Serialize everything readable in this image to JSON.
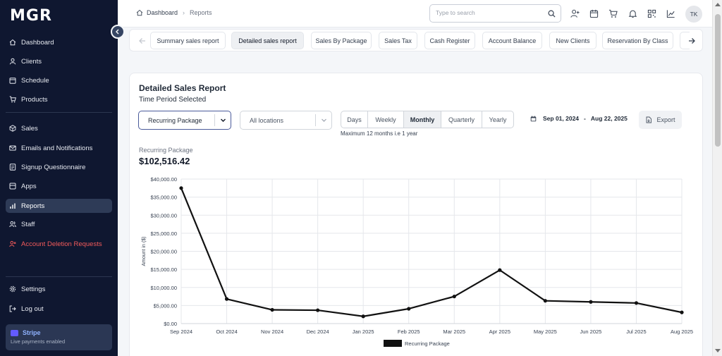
{
  "app": {
    "logo": "MGR"
  },
  "sidebar": {
    "items": [
      {
        "label": "Dashboard",
        "icon": "home-icon"
      },
      {
        "label": "Clients",
        "icon": "user-icon"
      },
      {
        "label": "Schedule",
        "icon": "calendar-icon"
      },
      {
        "label": "Products",
        "icon": "cart-icon"
      },
      {
        "label": "Sales",
        "icon": "box-icon"
      },
      {
        "label": "Emails and Notifications",
        "icon": "mail-icon"
      },
      {
        "label": "Signup Questionnaire",
        "icon": "form-icon"
      },
      {
        "label": "Apps",
        "icon": "apps-icon"
      },
      {
        "label": "Reports",
        "icon": "bar-chart-icon",
        "active": true
      },
      {
        "label": "Staff",
        "icon": "users-icon"
      },
      {
        "label": "Account Deletion Requests",
        "icon": "user-x-icon"
      },
      {
        "label": "Settings",
        "icon": "gear-icon"
      },
      {
        "label": "Log out",
        "icon": "logout-icon"
      }
    ],
    "stripe": {
      "title": "Stripe",
      "subtitle": "Live payments enabled"
    }
  },
  "topbar": {
    "breadcrumb": {
      "home": "Dashboard",
      "current": "Reports"
    },
    "search_placeholder": "Type to search",
    "avatar": "TK"
  },
  "tabs": [
    {
      "label": "Summary sales report"
    },
    {
      "label": "Detailed sales report",
      "active": true
    },
    {
      "label": "Sales By Package"
    },
    {
      "label": "Sales Tax"
    },
    {
      "label": "Cash Register"
    },
    {
      "label": "Account Balance"
    },
    {
      "label": "New Clients"
    },
    {
      "label": "Reservation By Class"
    }
  ],
  "report": {
    "title": "Detailed Sales Report",
    "subtitle": "Time Period Selected",
    "package_select": "Recurring Package",
    "location_select": "All locations",
    "periods": [
      "Days",
      "Weekly",
      "Monthly",
      "Quarterly",
      "Yearly"
    ],
    "selected_period": "Monthly",
    "period_note": "Maximum 12 months i.e 1 year",
    "date_from": "Sep 01, 2024",
    "date_to": "Aug 22, 2025",
    "date_sep": "-",
    "export_label": "Export",
    "metric_label": "Recurring Package",
    "metric_value": "$102,516.42"
  },
  "colors": {
    "sidebar_bg": "#0f1730",
    "accent": "#3b4a8f",
    "danger": "#f25a5a",
    "line": "#111111"
  },
  "chart_data": {
    "type": "line",
    "categories": [
      "Sep 2024",
      "Oct 2024",
      "Nov 2024",
      "Dec 2024",
      "Jan 2025",
      "Feb 2025",
      "Mar 2025",
      "Apr 2025",
      "May 2025",
      "Jun 2025",
      "Jul 2025",
      "Aug 2025"
    ],
    "series": [
      {
        "name": "Recurring Package",
        "values": [
          37500,
          6800,
          3800,
          3700,
          2000,
          4100,
          7500,
          14800,
          6300,
          6000,
          5700,
          3100
        ]
      }
    ],
    "ylabel": "Amount in ($)",
    "ylim": [
      0,
      40000
    ],
    "yticks": [
      "$0.00",
      "$5,000.00",
      "$10,000.00",
      "$15,000.00",
      "$20,000.00",
      "$25,000.00",
      "$30,000.00",
      "$35,000.00",
      "$40,000.00"
    ],
    "legend": "bottom-center",
    "grid": true
  }
}
